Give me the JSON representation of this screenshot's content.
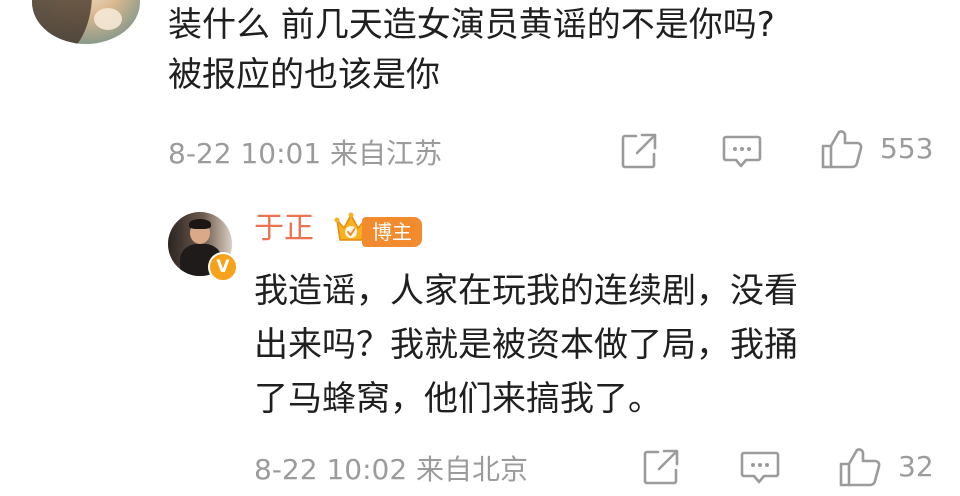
{
  "comment": {
    "text_line1": "装什么 前几天造女演员黄谣的不是你吗?",
    "text_line2": "被报应的也该是你",
    "meta": "8-22 10:01 来自江苏",
    "like_count": "553",
    "icons": [
      "share-icon",
      "comment-icon",
      "like-icon"
    ]
  },
  "reply": {
    "author": "于正",
    "badge_label": "博主",
    "verified_mark": "V",
    "text_line1": "我造谣，人家在玩我的连续剧，没看",
    "text_line2": "出来吗？我就是被资本做了局，我捅",
    "text_line3": "了马蜂窝，他们来搞我了。",
    "meta": "8-22 10:02 来自北京",
    "like_count": "32",
    "icons": [
      "share-icon",
      "comment-icon",
      "like-icon"
    ]
  },
  "colors": {
    "text": "#1f1f1f",
    "meta": "#9b9b9b",
    "author_name": "#eb7350",
    "badge": "#f28a2e",
    "verified": "#f7a21b"
  }
}
